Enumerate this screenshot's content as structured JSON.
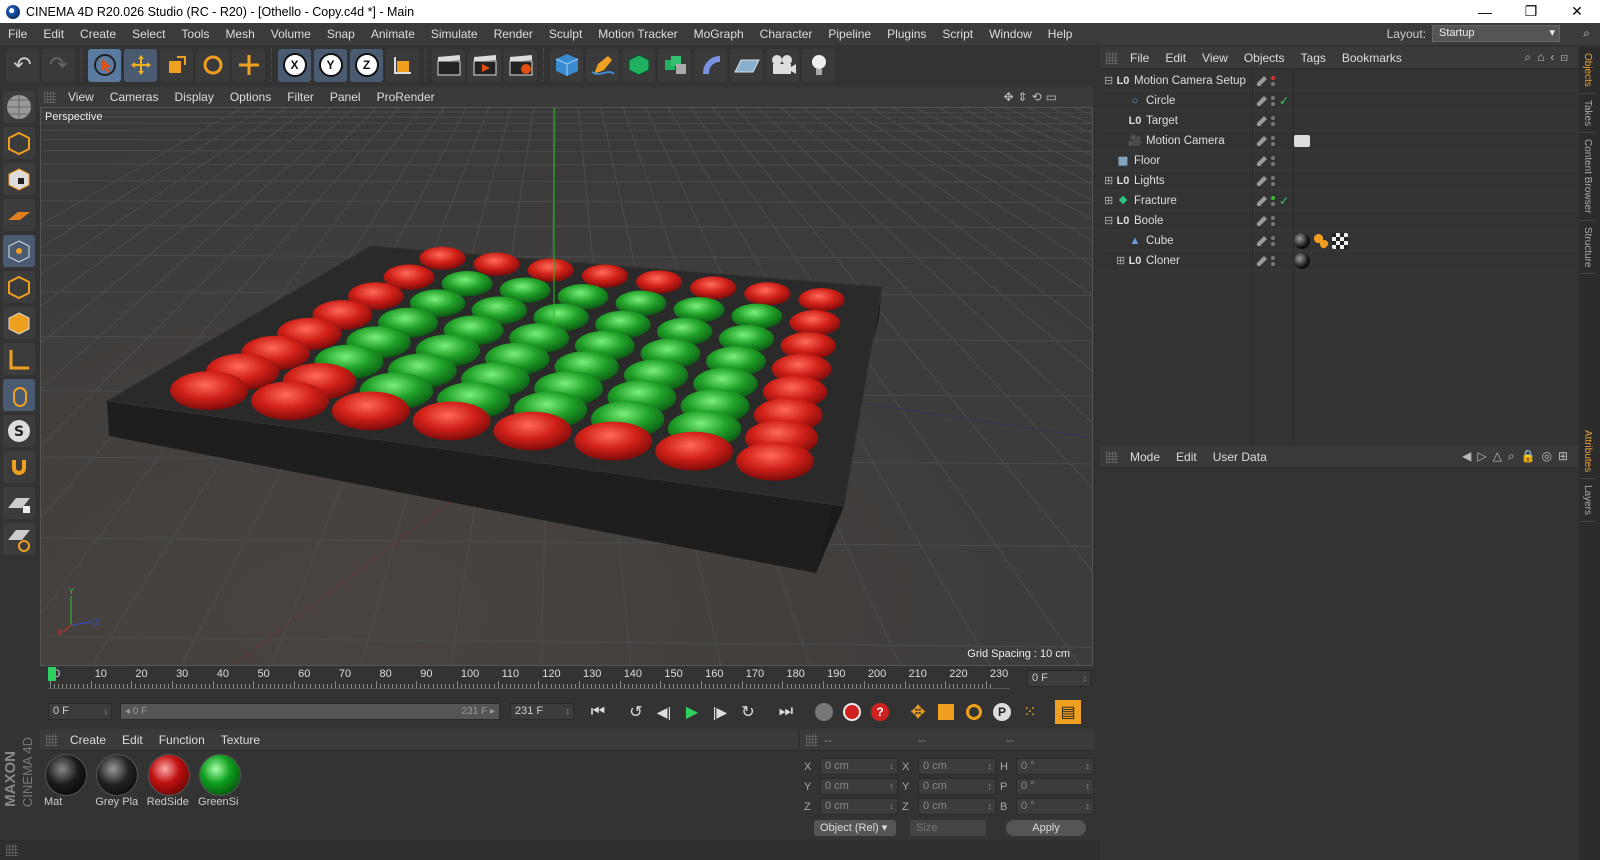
{
  "window": {
    "title": "CINEMA 4D R20.026 Studio (RC - R20) - [Othello - Copy.c4d *] - Main",
    "min": "—",
    "max": "❐",
    "close": "✕"
  },
  "menubar": [
    "File",
    "Edit",
    "Create",
    "Select",
    "Tools",
    "Mesh",
    "Volume",
    "Snap",
    "Animate",
    "Simulate",
    "Render",
    "Sculpt",
    "Motion Tracker",
    "MoGraph",
    "Character",
    "Pipeline",
    "Plugins",
    "Script",
    "Window",
    "Help"
  ],
  "layout": {
    "label": "Layout:",
    "value": "Startup"
  },
  "toolbar": {
    "undo": "↶",
    "redo": "↷",
    "x_axis": "X",
    "y_axis": "Y",
    "z_axis": "Z"
  },
  "viewport": {
    "menu": [
      "View",
      "Cameras",
      "Display",
      "Options",
      "Filter",
      "Panel",
      "ProRender"
    ],
    "name": "Perspective",
    "grid_spacing": "Grid Spacing : 10 cm"
  },
  "timeline": {
    "ticks": [
      "0",
      "10",
      "20",
      "30",
      "40",
      "50",
      "60",
      "70",
      "80",
      "90",
      "100",
      "110",
      "120",
      "130",
      "140",
      "150",
      "160",
      "170",
      "180",
      "190",
      "200",
      "210",
      "220",
      "230"
    ],
    "current_frame": "0 F"
  },
  "transport": {
    "start_field": "0 F",
    "range_start": "◂ 0 F",
    "range_end": "231 F ▸",
    "end_field": "231 F"
  },
  "materials": {
    "menu": [
      "Create",
      "Edit",
      "Function",
      "Texture"
    ],
    "items": [
      {
        "name": "Mat",
        "color": "#1a1a1a"
      },
      {
        "name": "Grey Pla",
        "color": "#222222"
      },
      {
        "name": "RedSide",
        "color": "#c01010"
      },
      {
        "name": "GreenSi",
        "color": "#10a020"
      }
    ]
  },
  "coords": {
    "headers": [
      "--",
      "--",
      "--"
    ],
    "rows": [
      {
        "l1": "X",
        "v1": "0 cm",
        "l2": "X",
        "v2": "0 cm",
        "l3": "H",
        "v3": "0 °"
      },
      {
        "l1": "Y",
        "v1": "0 cm",
        "l2": "Y",
        "v2": "0 cm",
        "l3": "P",
        "v3": "0 °"
      },
      {
        "l1": "Z",
        "v1": "0 cm",
        "l2": "Z",
        "v2": "0 cm",
        "l3": "B",
        "v3": "0 °"
      }
    ],
    "mode": "Object (Rel)",
    "size": "Size",
    "apply": "Apply"
  },
  "objects": {
    "menu": [
      "File",
      "Edit",
      "View",
      "Objects",
      "Tags",
      "Bookmarks"
    ],
    "items": [
      {
        "name": "Motion Camera Setup",
        "indent": 0,
        "expand": "⊟",
        "icon": "L0"
      },
      {
        "name": "Circle",
        "indent": 1,
        "expand": "",
        "icon": "○"
      },
      {
        "name": "Target",
        "indent": 1,
        "expand": "",
        "icon": "L0"
      },
      {
        "name": "Motion Camera",
        "indent": 1,
        "expand": "",
        "icon": "🎥"
      },
      {
        "name": "Floor",
        "indent": 0,
        "expand": "",
        "icon": "▦"
      },
      {
        "name": "Lights",
        "indent": 0,
        "expand": "⊞",
        "icon": "L0"
      },
      {
        "name": "Fracture",
        "indent": 0,
        "expand": "⊞",
        "icon": "❖"
      },
      {
        "name": "Boole",
        "indent": 0,
        "expand": "⊟",
        "icon": "L0"
      },
      {
        "name": "Cube",
        "indent": 1,
        "expand": "",
        "icon": "▲"
      },
      {
        "name": "Cloner",
        "indent": 1,
        "expand": "⊞",
        "icon": "L0"
      }
    ]
  },
  "attributes": {
    "menu": [
      "Mode",
      "Edit",
      "User Data"
    ]
  },
  "side_tabs": [
    "Objects",
    "Takes",
    "Content Browser",
    "Structure",
    "Attributes",
    "Layers"
  ],
  "branding": {
    "maxon": "MAXON",
    "product": "CINEMA 4D"
  }
}
